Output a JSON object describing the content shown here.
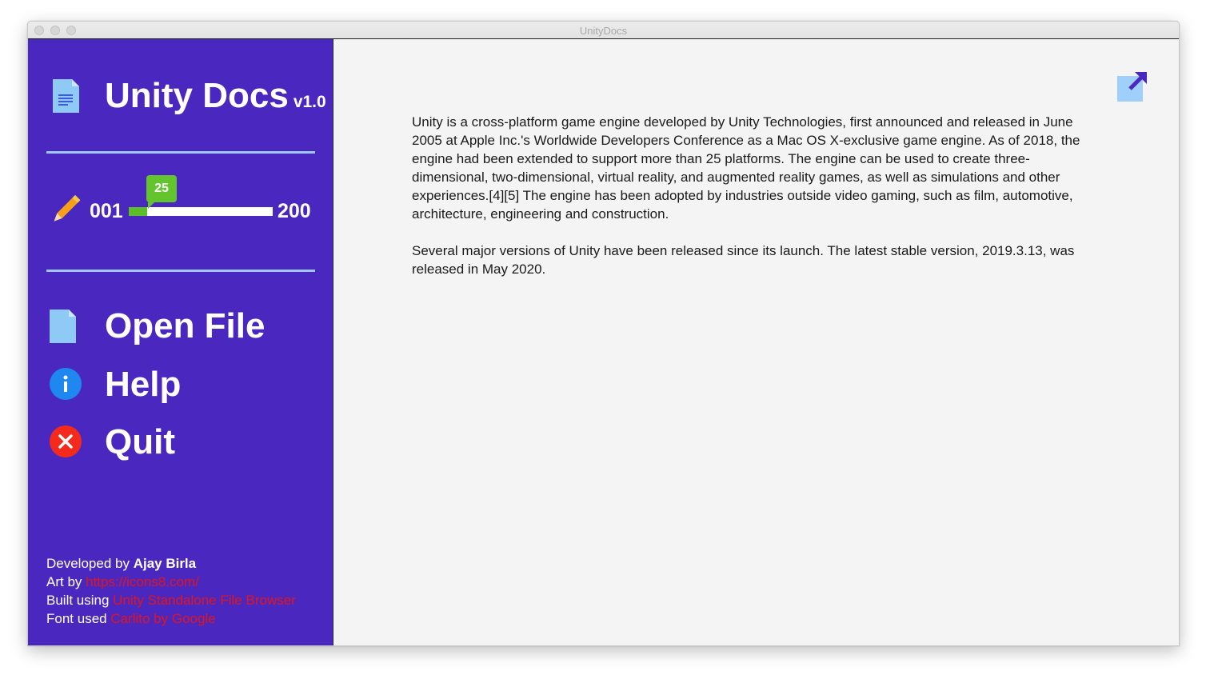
{
  "window": {
    "title": "UnityDocs"
  },
  "brand": {
    "title": "Unity Docs",
    "version": "v1.0"
  },
  "range": {
    "min_label": "001",
    "max_label": "200",
    "slider_value": "25",
    "slider_fraction": 0.125
  },
  "menu": {
    "items": [
      {
        "label": "Open File",
        "icon": "file-icon"
      },
      {
        "label": "Help",
        "icon": "info-icon"
      },
      {
        "label": "Quit",
        "icon": "close-icon"
      }
    ]
  },
  "credits": {
    "developed_prefix": "Developed by ",
    "developer": "Ajay Birla",
    "art_prefix": "Art by ",
    "art_link": "https://icons8.com/",
    "built_prefix": "Built using ",
    "built_link": "Unity Standalone File Browser",
    "font_prefix": "Font used ",
    "font_link": "Carlito by Google"
  },
  "content": {
    "paragraphs": [
      "Unity is a cross-platform game engine developed by Unity Technologies, first announced and released in June 2005 at Apple Inc.'s Worldwide Developers Conference as a Mac OS X-exclusive game engine. As of 2018, the engine had been extended to support more than 25 platforms. The engine can be used to create three-dimensional, two-dimensional, virtual reality, and augmented reality games, as well as simulations and other experiences.[4][5] The engine has been adopted by industries outside video gaming, such as film, automotive, architecture, engineering and construction.",
      "Several major versions of Unity have been released since its launch. The latest stable version, 2019.3.13, was released in May 2020."
    ]
  },
  "colors": {
    "sidebar": "#4a28bf",
    "divider": "#9fc7ff",
    "slider_badge": "#64c42e",
    "link": "#e3141c",
    "content_bg": "#f4f4f4"
  }
}
